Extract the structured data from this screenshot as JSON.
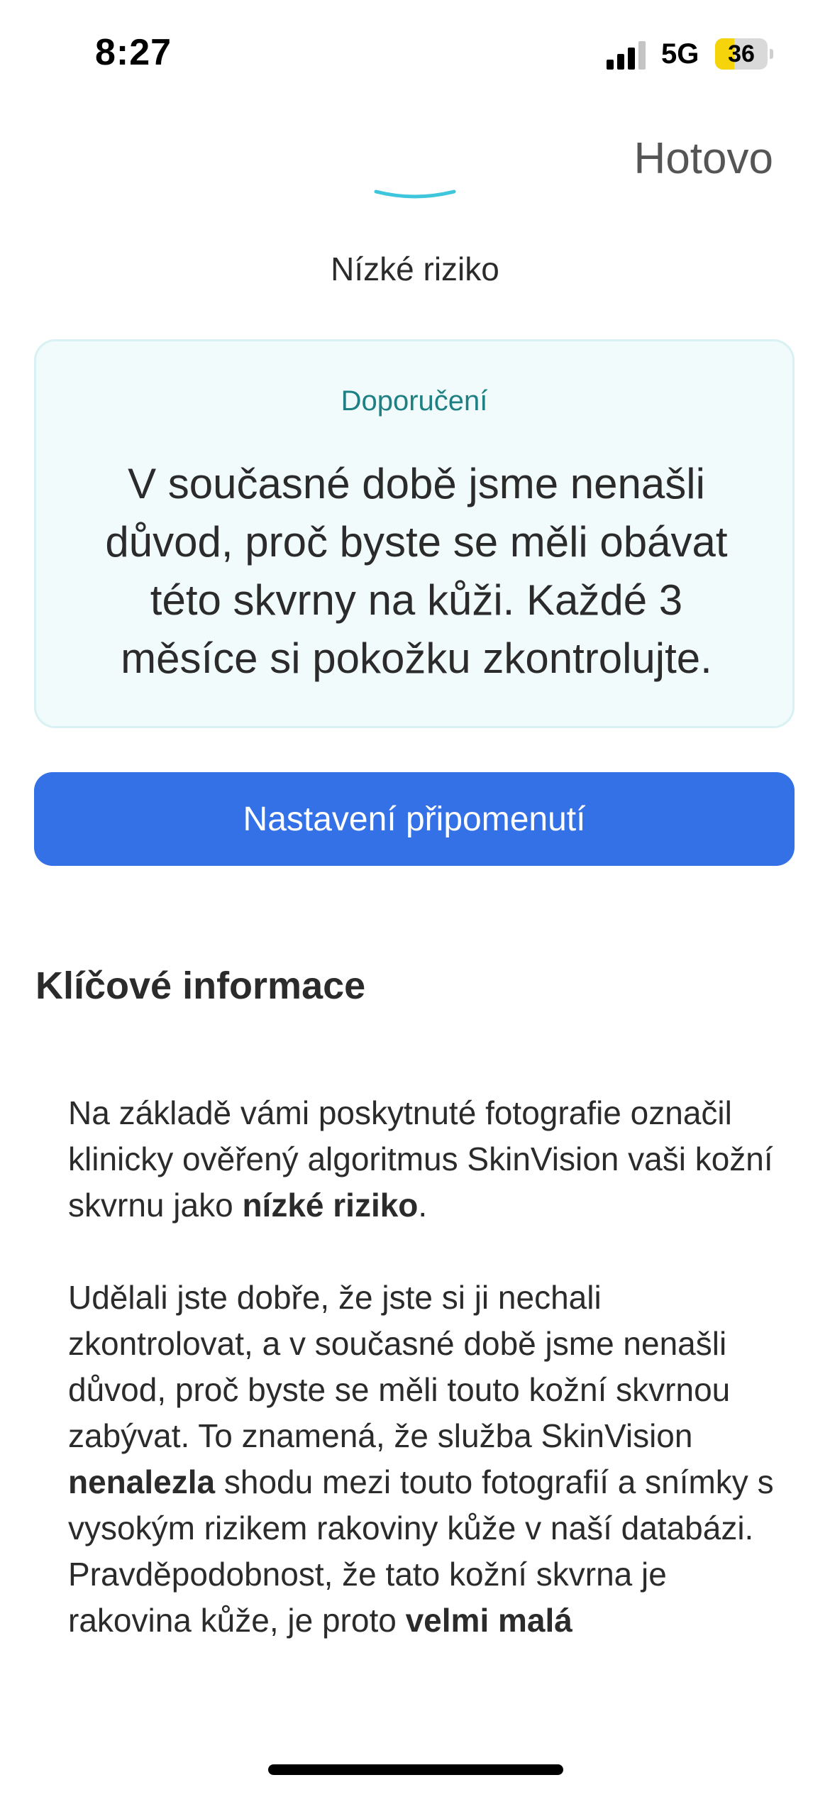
{
  "status_bar": {
    "time": "8:27",
    "network": "5G",
    "battery_level": "36",
    "battery_fraction": 0.36,
    "signal_icon": "cellular-signal-icon",
    "battery_icon": "battery-icon",
    "battery_color": "#f5d40c"
  },
  "header": {
    "done_label": "Hotovo"
  },
  "risk": {
    "label": "Nízké riziko",
    "gauge_icon": "risk-gauge-arc-icon",
    "gauge_color": "#3ec6dd"
  },
  "recommendation": {
    "title": "Doporučení",
    "text": "V současné době jsme nenašli důvod, proč byste se měli obávat této skvrny na kůži. Každé 3 měsíce si pokožku zkontrolujte."
  },
  "reminder_button": {
    "label": "Nastavení připomenutí",
    "color": "#3471e6"
  },
  "key_info": {
    "heading": "Klíčové informace",
    "paragraph1": {
      "part1": "Na základě vámi poskytnuté fotografie označil klinicky ověřený algoritmus SkinVision vaši kožní skvrnu jako ",
      "bold1": "nízké riziko",
      "part2": "."
    },
    "paragraph2": {
      "part1": "Udělali jste dobře, že jste si ji nechali zkontrolovat, a v současné době jsme nenašli důvod, proč byste se měli touto kožní skvrnou zabývat. To znamená, že služba SkinVision ",
      "bold1": "nenalezla",
      "part2": " shodu mezi touto fotografií a snímky s vysokým rizikem rakoviny kůže v naší databázi. Pravděpodobnost, že tato kožní skvrna je rakovina kůže, je proto ",
      "bold2": "velmi malá"
    }
  }
}
